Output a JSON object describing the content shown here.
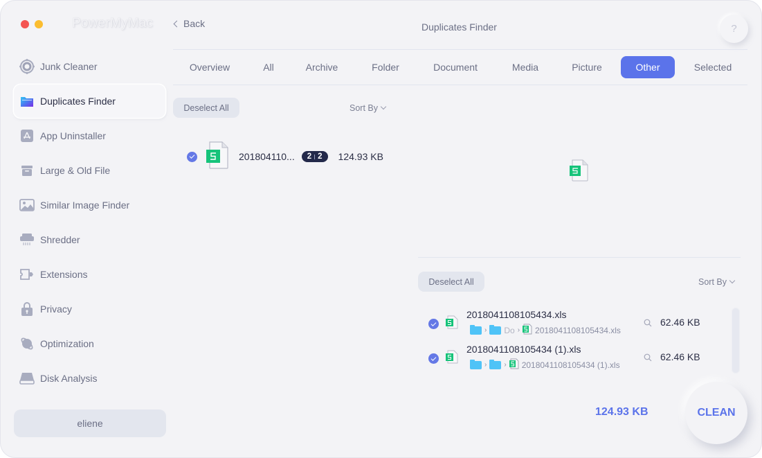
{
  "app": {
    "title": "PowerMyMac",
    "back_label": "Back",
    "page_title": "Duplicates Finder",
    "help_label": "?"
  },
  "sidebar": {
    "items": [
      {
        "label": "Junk Cleaner",
        "icon": "junk-cleaner-icon"
      },
      {
        "label": "Duplicates Finder",
        "icon": "folder-icon",
        "active": true
      },
      {
        "label": "App Uninstaller",
        "icon": "app-store-icon"
      },
      {
        "label": "Large & Old File",
        "icon": "box-icon"
      },
      {
        "label": "Similar Image Finder",
        "icon": "image-icon"
      },
      {
        "label": "Shredder",
        "icon": "shredder-icon"
      },
      {
        "label": "Extensions",
        "icon": "plugin-icon"
      },
      {
        "label": "Privacy",
        "icon": "lock-icon"
      },
      {
        "label": "Optimization",
        "icon": "planet-icon"
      },
      {
        "label": "Disk Analysis",
        "icon": "disk-icon"
      }
    ],
    "user_label": "eliene"
  },
  "tabs": [
    {
      "label": "Overview"
    },
    {
      "label": "All"
    },
    {
      "label": "Archive"
    },
    {
      "label": "Folder"
    },
    {
      "label": "Document"
    },
    {
      "label": "Media"
    },
    {
      "label": "Picture"
    },
    {
      "label": "Other",
      "active": true
    },
    {
      "label": "Selected"
    }
  ],
  "left_panel": {
    "deselect_label": "Deselect All",
    "sort_label": "Sort By",
    "groups": [
      {
        "name": "201804110...",
        "badge_left": "2",
        "badge_right": "2",
        "size": "124.93 KB",
        "checked": true
      }
    ]
  },
  "right_panel": {
    "deselect_label": "Deselect All",
    "sort_label": "Sort By",
    "files": [
      {
        "name": "2018041108105434.xls",
        "path_mid": "Do",
        "path_file": "2018041108105434.xls",
        "size": "62.46 KB",
        "checked": true
      },
      {
        "name": "2018041108105434 (1).xls",
        "path_mid": "",
        "path_file": "2018041108105434 (1).xls",
        "size": "62.46 KB",
        "checked": true
      }
    ]
  },
  "footer": {
    "total_size": "124.93 KB",
    "clean_label": "CLEAN"
  },
  "colors": {
    "accent": "#5b73ea",
    "badge_bg": "#23294a",
    "spreadsheet_green": "#16c37a",
    "folder_blue": "#4fc3f7"
  }
}
